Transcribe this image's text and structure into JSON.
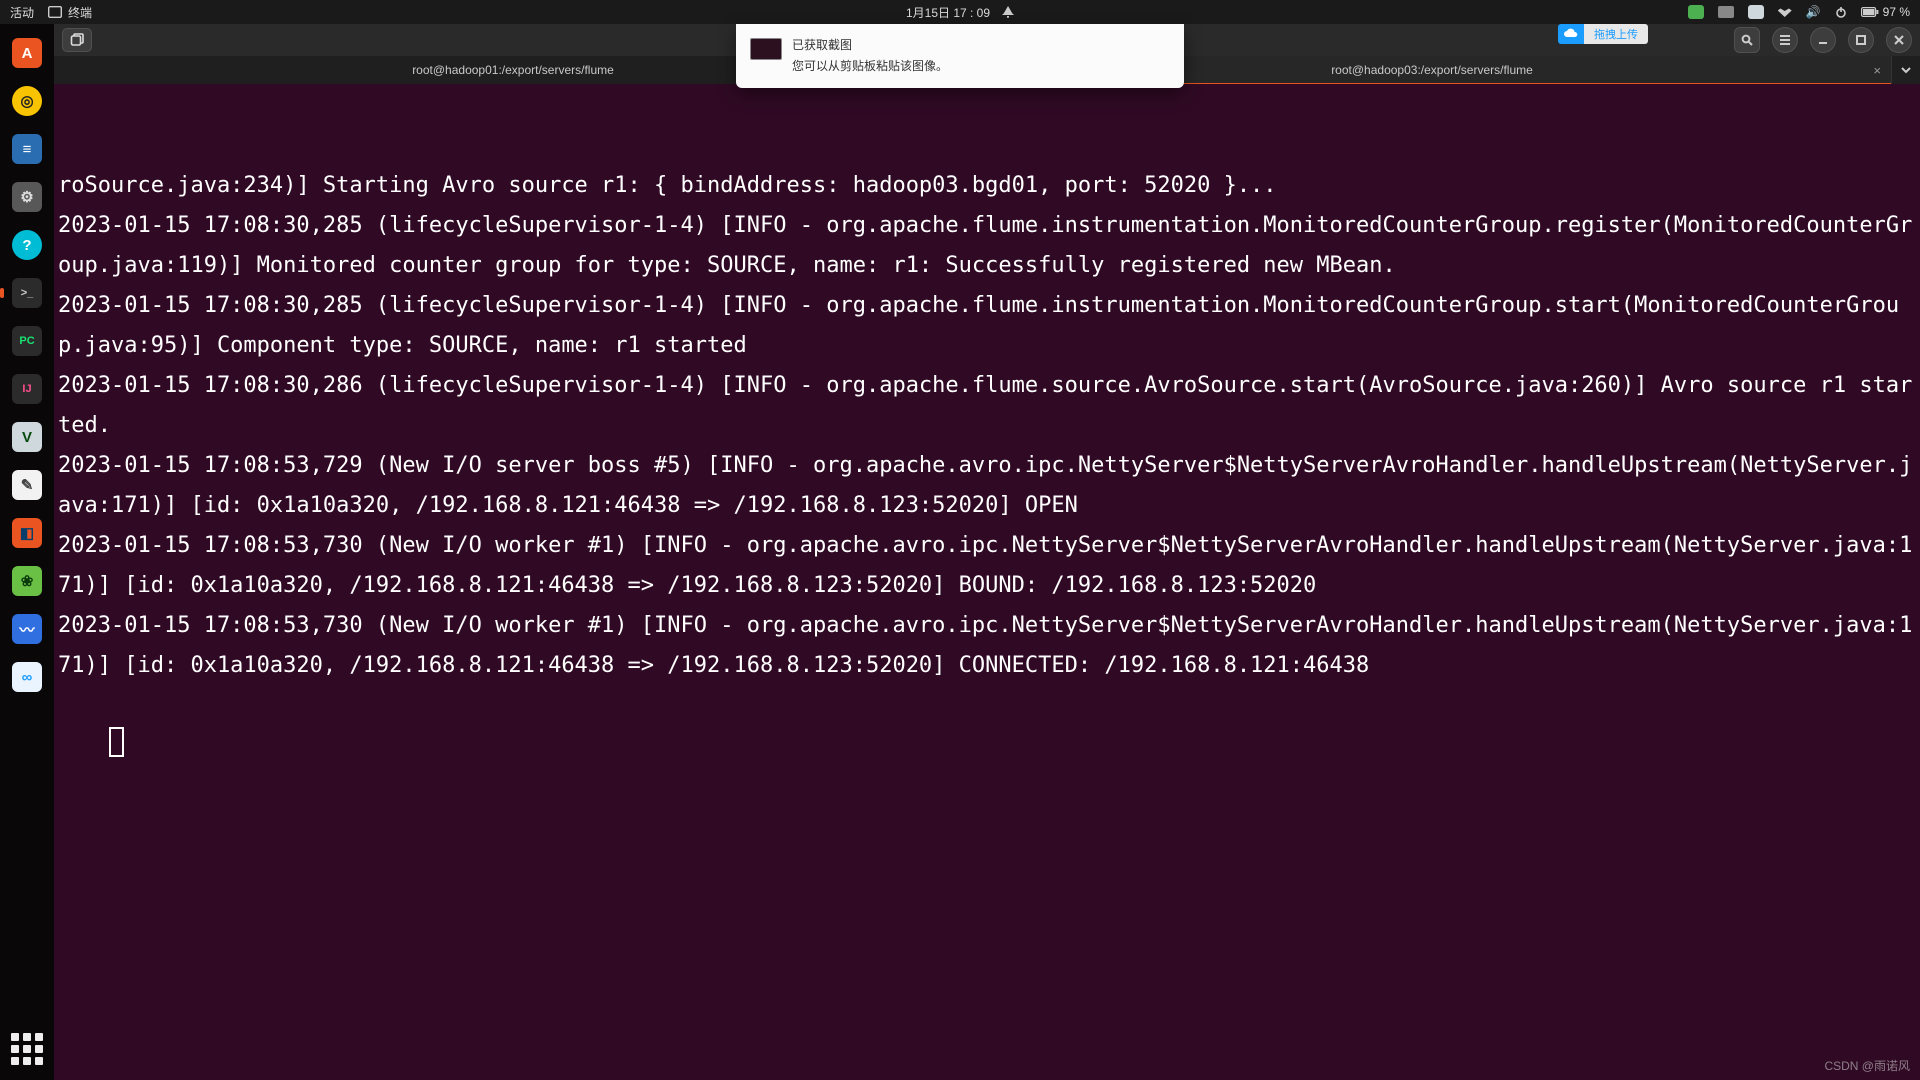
{
  "topbar": {
    "activities": "活动",
    "app_indicator": "终端",
    "clock": "1月15日  17 : 09",
    "battery": "97 %"
  },
  "upload_widget": {
    "label": "拖拽上传"
  },
  "toast": {
    "title": "已获取截图",
    "body": "您可以从剪贴板粘贴该图像。"
  },
  "dock": {
    "items": [
      {
        "name": "ubuntu-software",
        "glyph": "A",
        "cls": "sq-orange",
        "fg": "#fff"
      },
      {
        "name": "rhythmbox",
        "glyph": "◎",
        "cls": "sq-yellow",
        "fg": "#222"
      },
      {
        "name": "libreoffice-writer",
        "glyph": "≡",
        "cls": "sq-blue",
        "fg": "#fff"
      },
      {
        "name": "settings",
        "glyph": "⚙",
        "cls": "sq-grey",
        "fg": "#ddd"
      },
      {
        "name": "help",
        "glyph": "?",
        "cls": "sq-cyan",
        "fg": "#fff"
      },
      {
        "name": "terminal",
        "glyph": ">_",
        "cls": "sq-dark",
        "fg": "#ccc",
        "active": true,
        "small": true
      },
      {
        "name": "pycharm",
        "glyph": "PC",
        "cls": "sq-dark",
        "fg": "#19e370",
        "small": true
      },
      {
        "name": "intellij",
        "glyph": "IJ",
        "cls": "sq-dark",
        "fg": "#ff4d8d",
        "small": true
      },
      {
        "name": "vim",
        "glyph": "V",
        "cls": "sq-vim",
        "fg": "#0a4a12"
      },
      {
        "name": "text-editor",
        "glyph": "✎",
        "cls": "sq-white",
        "fg": "#444"
      },
      {
        "name": "vbox",
        "glyph": "◧",
        "cls": "sq-orange",
        "fg": "#063e6b"
      },
      {
        "name": "sys-monitor",
        "glyph": "❀",
        "cls": "sq-mint",
        "fg": "#0a3a0a"
      },
      {
        "name": "marktext",
        "glyph": "〰",
        "cls": "sq-chart",
        "fg": "#fff"
      },
      {
        "name": "baidu-netdisk",
        "glyph": "∞",
        "cls": "sq-cloud",
        "fg": "#1b9cff"
      }
    ]
  },
  "terminal": {
    "tabs": [
      {
        "title": "root@hadoop01:/export/servers/flume",
        "active": false
      },
      {
        "title": "",
        "active": false,
        "hidden": true
      },
      {
        "title": "root@hadoop03:/export/servers/flume",
        "active": true
      }
    ],
    "output": "roSource.java:234)] Starting Avro source r1: { bindAddress: hadoop03.bgd01, port: 52020 }...\n2023-01-15 17:08:30,285 (lifecycleSupervisor-1-4) [INFO - org.apache.flume.instrumentation.MonitoredCounterGroup.register(MonitoredCounterGroup.java:119)] Monitored counter group for type: SOURCE, name: r1: Successfully registered new MBean.\n2023-01-15 17:08:30,285 (lifecycleSupervisor-1-4) [INFO - org.apache.flume.instrumentation.MonitoredCounterGroup.start(MonitoredCounterGroup.java:95)] Component type: SOURCE, name: r1 started\n2023-01-15 17:08:30,286 (lifecycleSupervisor-1-4) [INFO - org.apache.flume.source.AvroSource.start(AvroSource.java:260)] Avro source r1 started.\n2023-01-15 17:08:53,729 (New I/O server boss #5) [INFO - org.apache.avro.ipc.NettyServer$NettyServerAvroHandler.handleUpstream(NettyServer.java:171)] [id: 0x1a10a320, /192.168.8.121:46438 => /192.168.8.123:52020] OPEN\n2023-01-15 17:08:53,730 (New I/O worker #1) [INFO - org.apache.avro.ipc.NettyServer$NettyServerAvroHandler.handleUpstream(NettyServer.java:171)] [id: 0x1a10a320, /192.168.8.121:46438 => /192.168.8.123:52020] BOUND: /192.168.8.123:52020\n2023-01-15 17:08:53,730 (New I/O worker #1) [INFO - org.apache.avro.ipc.NettyServer$NettyServerAvroHandler.handleUpstream(NettyServer.java:171)] [id: 0x1a10a320, /192.168.8.121:46438 => /192.168.8.123:52020] CONNECTED: /192.168.8.121:46438"
  },
  "watermark": "CSDN @雨诺风"
}
